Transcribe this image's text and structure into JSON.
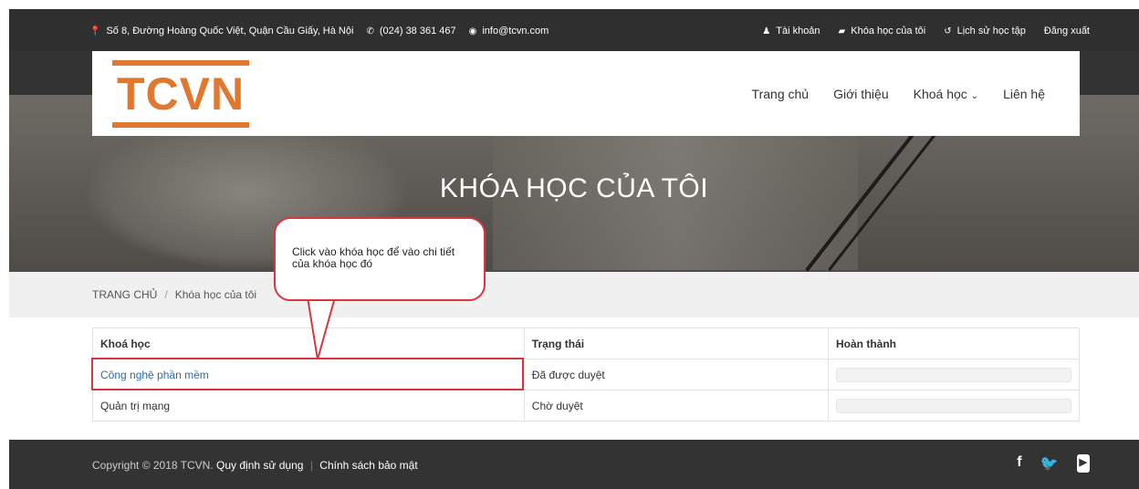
{
  "topbar": {
    "address": "Số 8, Đường Hoàng Quốc Việt, Quận Cầu Giấy, Hà Nội",
    "phone": "(024) 38 361 467",
    "email": "info@tcvn.com",
    "account": "Tài khoản",
    "my_courses": "Khóa học của tôi",
    "history": "Lịch sử học tập",
    "logout": "Đăng xuất"
  },
  "header": {
    "logo_text": "TCVN",
    "nav": [
      "Trang chủ",
      "Giới thiệu",
      "Khoá học",
      "Liên hệ"
    ]
  },
  "hero": {
    "title": "KHÓA HỌC CỦA TÔI"
  },
  "breadcrumb": {
    "home": "TRANG CHỦ",
    "separator": "/",
    "current": "Khóa học của tôi"
  },
  "callout": {
    "text": "Click vào khóa học để vào chi tiết của khóa học đó"
  },
  "table": {
    "headers": [
      "Khoá học",
      "Trạng thái",
      "Hoàn thành"
    ],
    "rows": [
      {
        "course": "Công nghệ phần mềm",
        "status": "Đã được duyệt",
        "progress_percent": 0
      },
      {
        "course": "Quản trị mạng",
        "status": "Chờ duyệt",
        "progress_percent": 0
      }
    ]
  },
  "footer": {
    "copyright": "Copyright © 2018 TCVN.",
    "terms": "Quy định sử dụng",
    "separator": "|",
    "privacy": "Chính sách bảo mật",
    "social": [
      "facebook-icon",
      "twitter-icon",
      "youtube-icon"
    ]
  },
  "colors": {
    "accent": "#e1782f",
    "highlight": "#d9363e",
    "link": "#2a6cb0"
  }
}
